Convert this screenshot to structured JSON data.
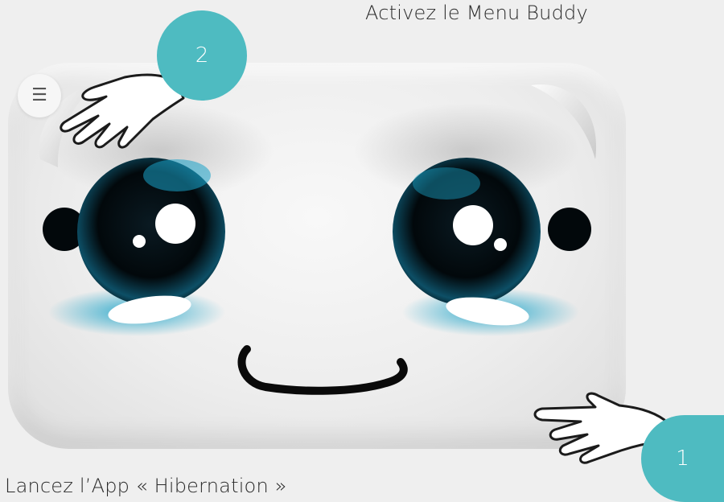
{
  "captions": {
    "top": "Activez le Menu Buddy",
    "bottom": "Lancez l’App « Hibernation »"
  },
  "steps": {
    "step_1": "1",
    "step_2": "2"
  },
  "menu_button": {
    "icon": "menu-icon",
    "glyph": "☰"
  },
  "colors": {
    "accent": "#4ebbc1",
    "eye_glow": "#1aa3c8",
    "background": "#efefef"
  }
}
